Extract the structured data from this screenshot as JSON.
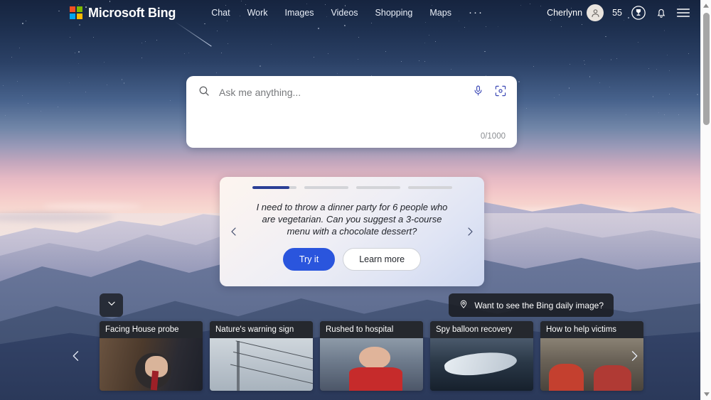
{
  "header": {
    "brand": "Microsoft Bing",
    "logo_icon": "microsoft-logo-icon",
    "nav": [
      {
        "label": "Chat"
      },
      {
        "label": "Work"
      },
      {
        "label": "Images"
      },
      {
        "label": "Videos"
      },
      {
        "label": "Shopping"
      },
      {
        "label": "Maps"
      }
    ],
    "more_label": "···",
    "user_name": "Cherlynn",
    "avatar_icon": "person-avatar-icon",
    "rewards_points": "55",
    "rewards_icon": "rewards-trophy-icon",
    "notifications_icon": "bell-icon",
    "menu_icon": "hamburger-menu-icon"
  },
  "search": {
    "placeholder": "Ask me anything...",
    "value": "",
    "search_icon": "search-icon",
    "mic_icon": "microphone-icon",
    "visual_icon": "visual-search-icon",
    "counter": "0/1000"
  },
  "suggestion_card": {
    "progress_total": 4,
    "progress_active_index": 0,
    "progress_active_fill": "85%",
    "text": "I need to throw a dinner party for 6 people who are vegetarian. Can you suggest a 3-course menu with a chocolate dessert?",
    "primary_button": "Try it",
    "secondary_button": "Learn more",
    "prev_icon": "chevron-left-icon",
    "next_icon": "chevron-right-icon"
  },
  "daily_image": {
    "label": "Want to see the Bing daily image?",
    "icon": "location-pin-icon"
  },
  "collapse_toggle": {
    "icon": "chevron-down-icon"
  },
  "news": {
    "prev_icon": "chevron-left-icon",
    "next_icon": "chevron-right-icon",
    "cards": [
      {
        "title": "Facing House probe",
        "photo_class": "p1"
      },
      {
        "title": "Nature's warning sign",
        "photo_class": "p2"
      },
      {
        "title": "Rushed to hospital",
        "photo_class": "p3"
      },
      {
        "title": "Spy balloon recovery",
        "photo_class": "p4"
      },
      {
        "title": "How to help victims",
        "photo_class": "p5"
      }
    ]
  },
  "scrollbar": {
    "up_icon": "scroll-up-arrow-icon",
    "down_icon": "scroll-down-arrow-icon"
  },
  "colors": {
    "accent_blue": "#2a55dd",
    "progress_active": "#2b3f96",
    "overlay_dark": "#191b20"
  }
}
